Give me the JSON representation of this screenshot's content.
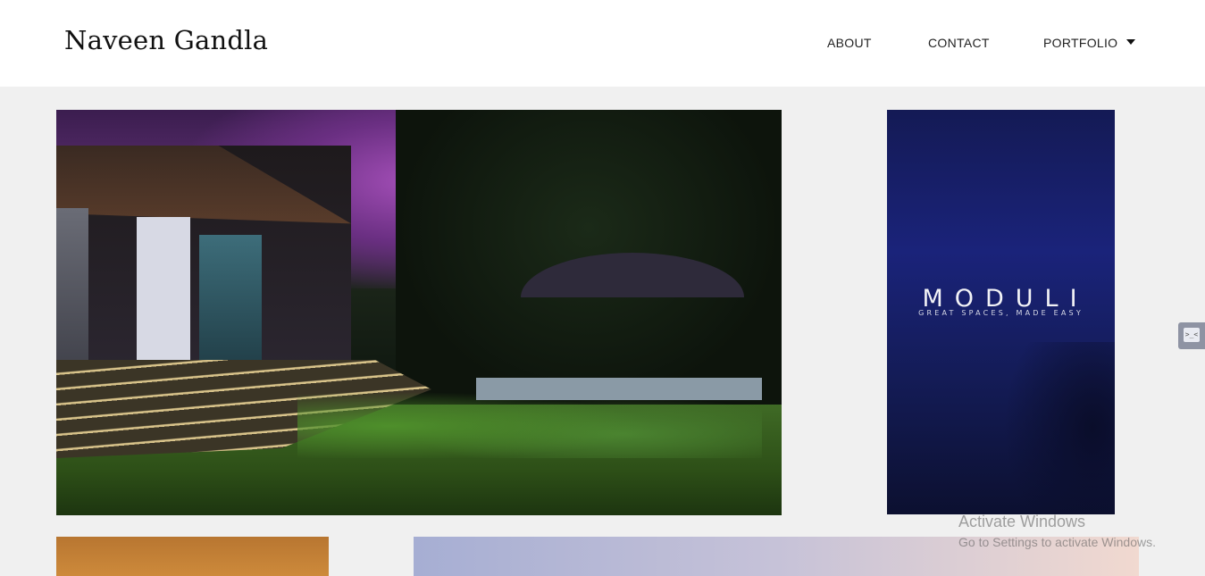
{
  "header": {
    "site_title": "Naveen Gandla",
    "nav": {
      "about": "ABOUT",
      "contact": "CONTACT",
      "portfolio": "PORTFOLIO"
    }
  },
  "gallery": {
    "poster": {
      "brand": "MODULI",
      "tagline": "GREAT SPACES, MADE EASY"
    }
  },
  "watermark": {
    "title": "Activate Windows",
    "subtitle": "Go to Settings to activate Windows."
  },
  "side_widget": {
    "icon": "code-icon",
    "glyph": ">_<"
  },
  "colors": {
    "header_bg": "#ffffff",
    "page_bg": "#f0f0f0",
    "poster_bg": "#1a237a"
  }
}
